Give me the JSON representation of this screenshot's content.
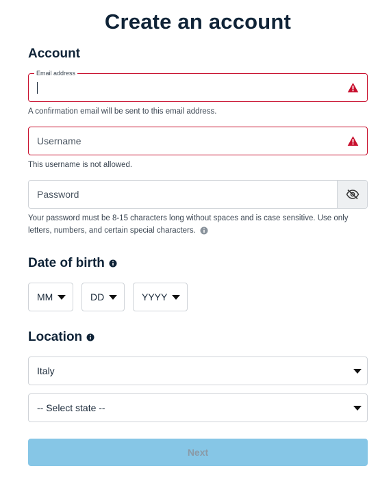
{
  "page": {
    "title": "Create an account"
  },
  "account_section": {
    "heading": "Account",
    "email": {
      "label": "Email address",
      "value": "",
      "helper": "A confirmation email will be sent to this email address.",
      "state": "error"
    },
    "username": {
      "placeholder": "Username",
      "value": "",
      "helper": "This username is not allowed.",
      "state": "error"
    },
    "password": {
      "placeholder": "Password",
      "value": "",
      "helper_line1": "Your password must be 8-15 characters long without spaces and is case sensitive. Use only",
      "helper_line2": "letters, numbers, and certain special characters.",
      "toggle_icon": "eye-slash-icon"
    }
  },
  "dob_section": {
    "heading": "Date of birth",
    "month": {
      "value": "MM"
    },
    "day": {
      "value": "DD"
    },
    "year": {
      "value": "YYYY"
    }
  },
  "location_section": {
    "heading": "Location",
    "country": {
      "value": "Italy"
    },
    "state": {
      "value": "-- Select state --"
    }
  },
  "actions": {
    "next_label": "Next",
    "next_enabled": false
  },
  "colors": {
    "error": "#c8102e",
    "primary_disabled": "#86c6e6",
    "heading": "#0f2337"
  }
}
